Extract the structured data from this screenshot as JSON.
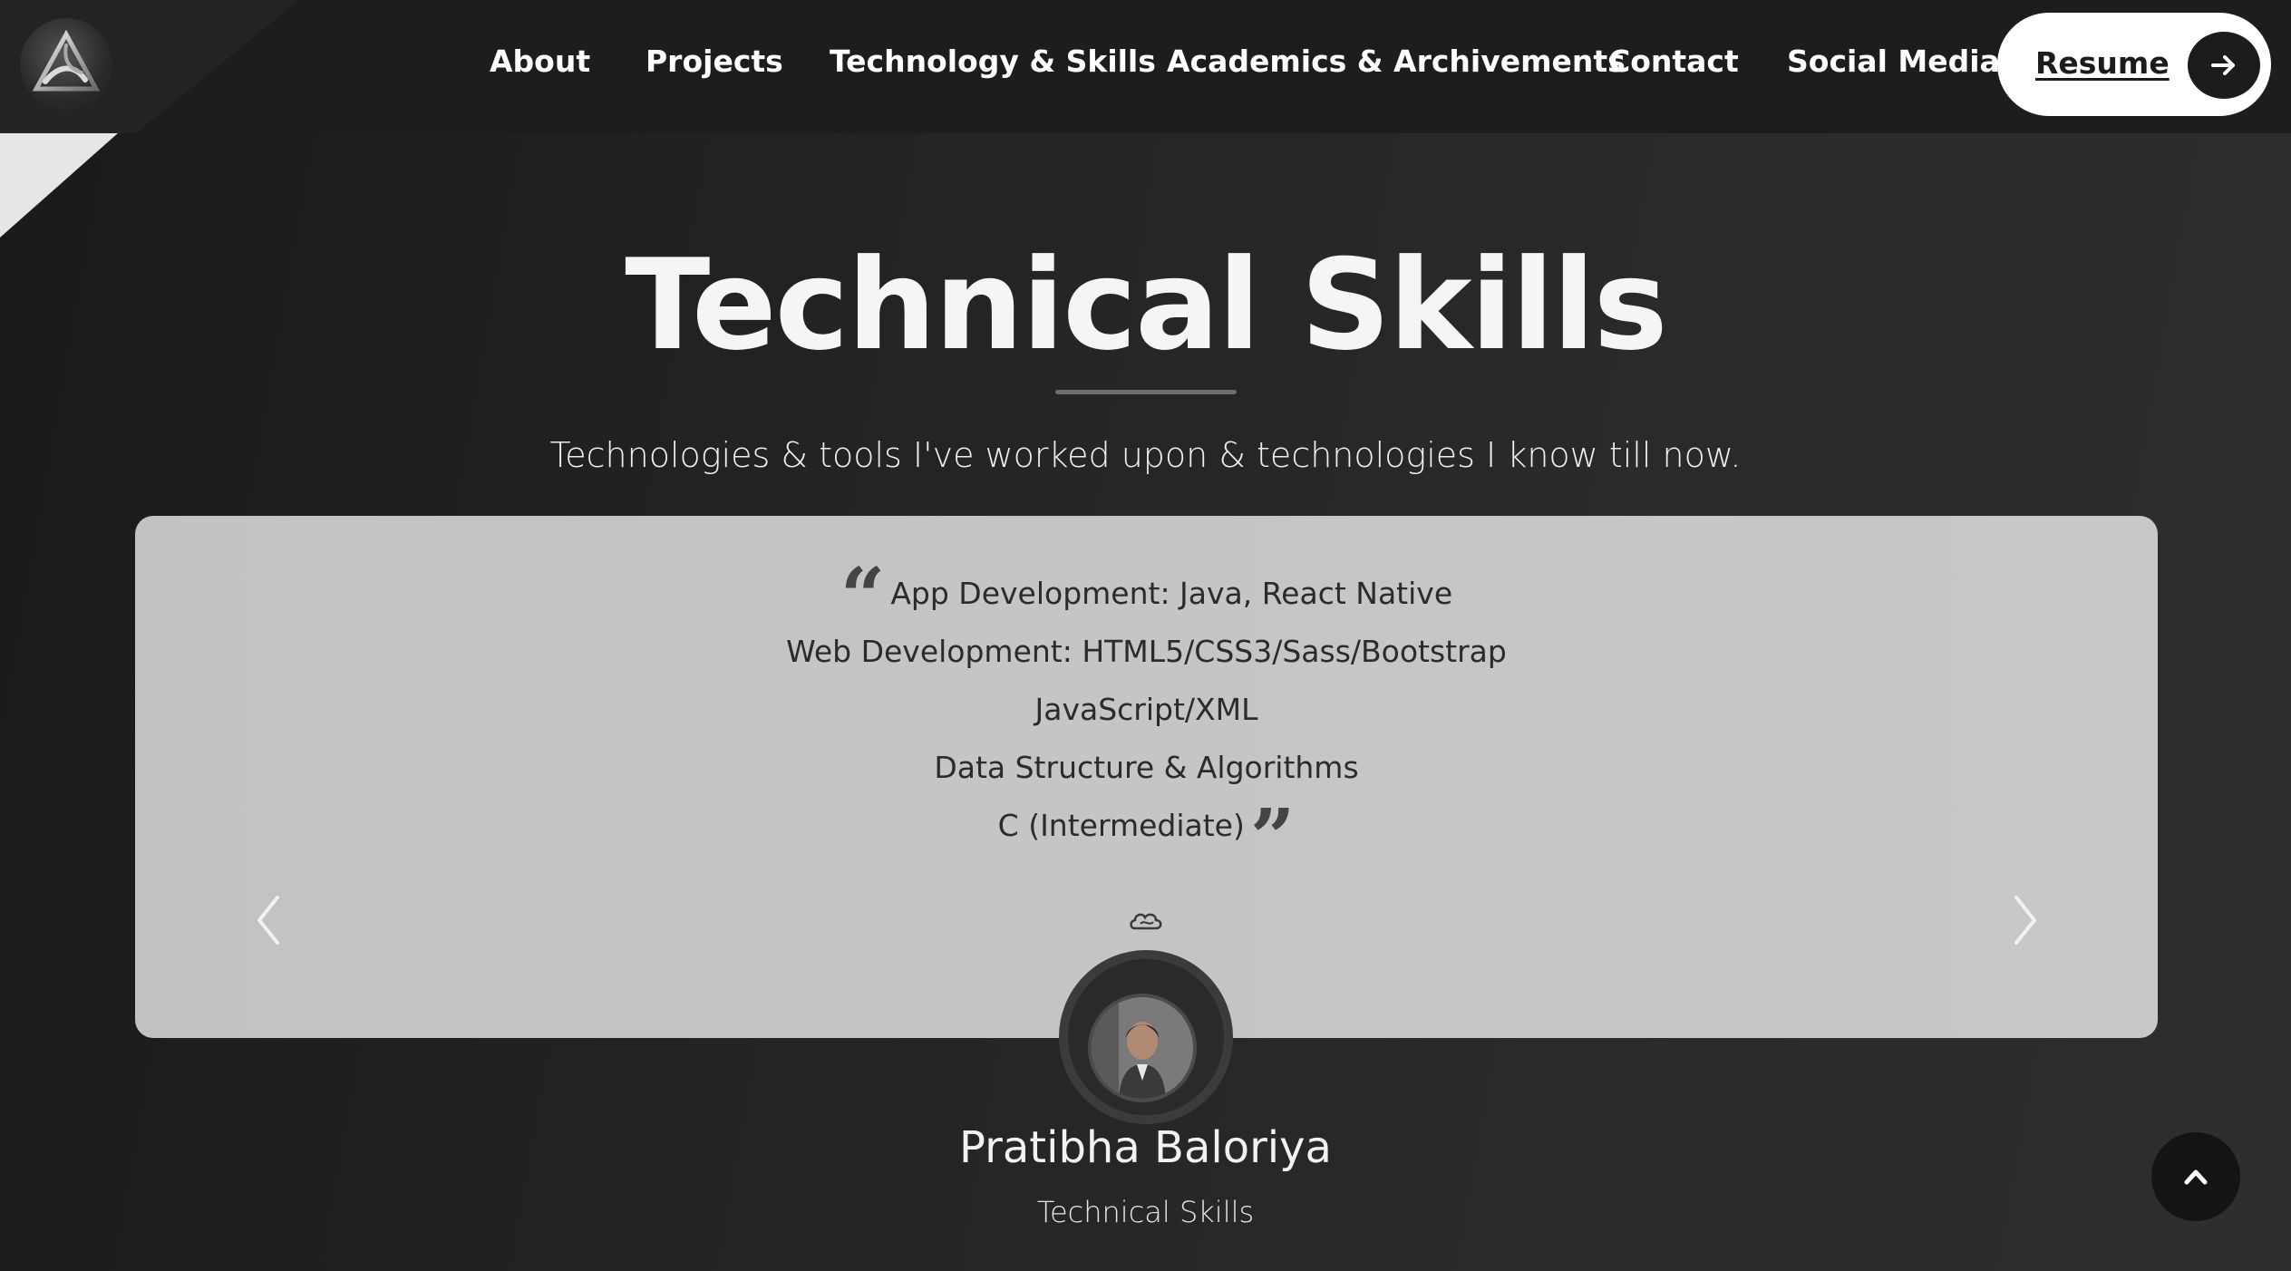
{
  "nav": {
    "items": [
      {
        "label": "About"
      },
      {
        "label": "Projects"
      },
      {
        "label": "Technology & Skills"
      },
      {
        "label": "Academics & Archivements"
      },
      {
        "label": "Contact"
      },
      {
        "label": "Social Media"
      }
    ],
    "resume_label": "Resume",
    "logo_icon": "triangle-logo-icon"
  },
  "section": {
    "title": "Technical Skills",
    "subtitle": "Technologies & tools I've worked upon & technologies I know till now."
  },
  "testimonial": {
    "lines": [
      "App Development: Java, React Native",
      "Web Development: HTML5/CSS3/Sass/Bootstrap",
      "JavaScript/XML",
      "Data Structure & Algorithms",
      "C (Intermediate)"
    ],
    "name": "Pratibha Baloriya",
    "role": "Technical Skills"
  },
  "colors": {
    "background": "#242424",
    "navbar": "#1d1d1d",
    "card": "#c6c5c5",
    "text_light": "#ffffff",
    "text_dark": "#2b2b2b"
  }
}
